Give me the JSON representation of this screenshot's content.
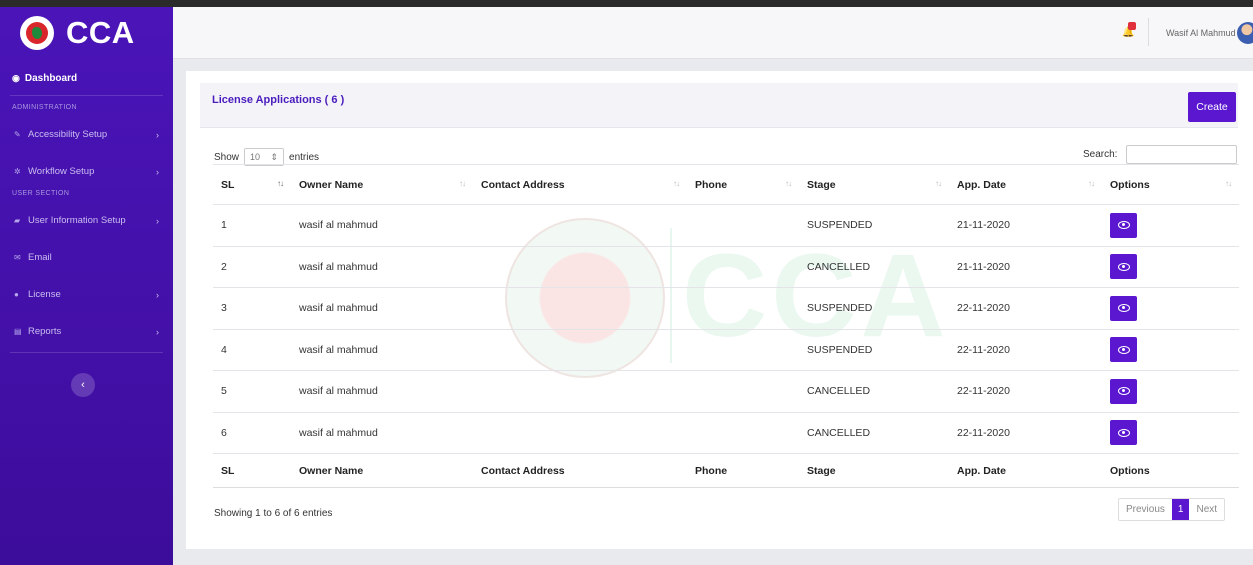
{
  "app": {
    "brand": "CCA"
  },
  "sidebar": {
    "dashboard_label": "Dashboard",
    "section_admin": "ADMINISTRATION",
    "section_user": "USER SECTION",
    "items": [
      {
        "label": "Accessibility Setup",
        "icon": "wrench-icon",
        "chevron": "›"
      },
      {
        "label": "Workflow Setup",
        "icon": "gear-icon",
        "chevron": "›"
      },
      {
        "label": "User Information Setup",
        "icon": "folder-icon",
        "chevron": "›"
      },
      {
        "label": "Email",
        "icon": "email-icon",
        "chevron": ""
      },
      {
        "label": "License",
        "icon": "license-icon",
        "chevron": "›"
      },
      {
        "label": "Reports",
        "icon": "report-icon",
        "chevron": "›"
      }
    ],
    "collapse_glyph": "‹"
  },
  "topbar": {
    "username": "Wasif Al Mahmud"
  },
  "card": {
    "title": "License Applications ( 6 )",
    "create_label": "Create"
  },
  "controls": {
    "show_label": "Show",
    "entries_value": "10",
    "entries_label": "entries",
    "search_label": "Search:"
  },
  "table": {
    "columns": [
      "SL",
      "Owner Name",
      "Contact Address",
      "Phone",
      "Stage",
      "App. Date",
      "Options"
    ],
    "rows": [
      {
        "sl": "1",
        "owner": "wasif al mahmud",
        "address": "",
        "phone": "",
        "stage": "SUSPENDED",
        "date": "21-11-2020"
      },
      {
        "sl": "2",
        "owner": "wasif al mahmud",
        "address": "",
        "phone": "",
        "stage": "CANCELLED",
        "date": "21-11-2020"
      },
      {
        "sl": "3",
        "owner": "wasif al mahmud",
        "address": "",
        "phone": "",
        "stage": "SUSPENDED",
        "date": "22-11-2020"
      },
      {
        "sl": "4",
        "owner": "wasif al mahmud",
        "address": "",
        "phone": "",
        "stage": "SUSPENDED",
        "date": "22-11-2020"
      },
      {
        "sl": "5",
        "owner": "wasif al mahmud",
        "address": "",
        "phone": "",
        "stage": "CANCELLED",
        "date": "22-11-2020"
      },
      {
        "sl": "6",
        "owner": "wasif al mahmud",
        "address": "",
        "phone": "",
        "stage": "CANCELLED",
        "date": "22-11-2020"
      }
    ],
    "info": "Showing 1 to 6 of 6 entries",
    "pager": {
      "previous": "Previous",
      "current": "1",
      "next": "Next"
    }
  },
  "colors": {
    "sidebar": "#4a14b8",
    "accent": "#5a17cf",
    "title": "#4a1cbe"
  }
}
